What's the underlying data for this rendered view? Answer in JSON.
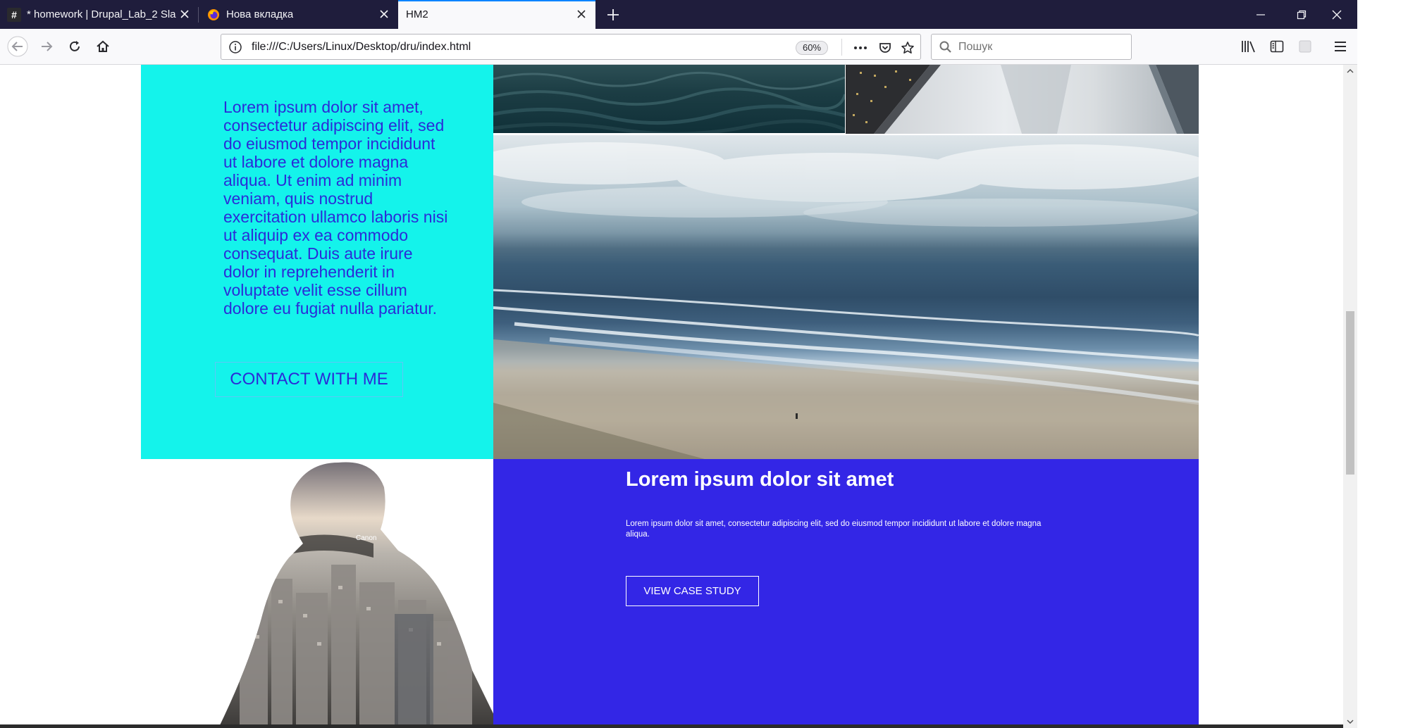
{
  "tabs": [
    {
      "title": "* homework | Drupal_Lab_2 Sla",
      "favicon": "hash-icon"
    },
    {
      "title": "Нова вкладка",
      "favicon": "firefox-icon"
    },
    {
      "title": "HM2",
      "favicon": ""
    }
  ],
  "navbar": {
    "url": "file:///C:/Users/Linux/Desktop/dru/index.html",
    "zoom": "60%",
    "search_placeholder": "Пошук"
  },
  "hero": {
    "text": "Lorem ipsum dolor sit amet, consectetur adipiscing elit, sed do eiusmod tempor incididunt ut labore et dolore magna aliqua. Ut enim ad minim veniam, quis nostrud exercitation ullamco laboris nisi ut aliquip ex ea commodo consequat. Duis aute irure dolor in reprehenderit in voluptate velit esse cillum dolore eu fugiat nulla pariatur.",
    "button_label": "CONTACT WITH ME"
  },
  "case": {
    "title": "Lorem ipsum dolor sit amet",
    "text": "Lorem ipsum dolor sit amet, consectetur adipiscing elit, sed do eiusmod tempor incididunt ut labore et dolore magna aliqua.",
    "button_label": "VIEW CASE STUDY",
    "camera_brand": "Canon"
  },
  "colors": {
    "tabbar": "#1f1d3c",
    "cyan_panel": "#14f3eb",
    "cyan_text": "#2b2bd8",
    "blue_panel": "#3326e6",
    "accent_tab": "#0a84ff"
  }
}
